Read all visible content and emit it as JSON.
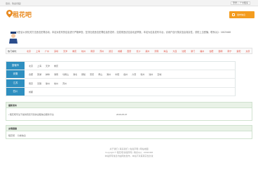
{
  "top": {
    "welcome": "您好，欢迎光临！",
    "login": "登录",
    "register": "广州租房"
  },
  "logo": {
    "text": "租花吧"
  },
  "post_button": {
    "label": "发布信息"
  },
  "notice": {
    "text": "为配合公安机关打击违法犯罪活动，本站对发布的信息进行严格审查，坚决杜绝违法犯罪信息的发布，如发现违法信息欢迎举报。本站为信息发布平台，请用户自行核实信息真实性，谨防上当受骗。联系QQ：16020468"
  },
  "cities": {
    "label": "热门城市：",
    "items": [
      "北京",
      "上海",
      "广州",
      "深圳",
      "天津",
      "重庆",
      "杭州",
      "南京",
      "苏州",
      "武汉",
      "成都",
      "西安",
      "长沙",
      "郑州",
      "济南",
      "青岛",
      "大连",
      "沈阳",
      "厦门",
      "福州",
      "合肥",
      "昆明",
      "南宁",
      "贵阳",
      "太原",
      "石家庄",
      "兰州",
      "海口"
    ]
  },
  "regions": [
    {
      "name": "直辖市",
      "items": [
        "北京",
        "上海",
        "天津",
        "重庆"
      ]
    },
    {
      "name": "安徽",
      "items": [
        "合肥",
        "芜湖",
        "蚌埠",
        "淮南",
        "马鞍山",
        "淮北",
        "铜陵",
        "安庆",
        "黄山",
        "滁州",
        "阜阳",
        "宿州",
        "六安",
        "亳州",
        "池州",
        "宣城"
      ]
    },
    {
      "name": "江苏",
      "items": [
        "南京",
        "无锡",
        "徐州",
        "常州",
        "苏州"
      ]
    },
    {
      "name": "四川",
      "items": [
        "成都"
      ]
    }
  ],
  "latest": {
    "title": "最新发布",
    "entry_text": "• 租花吧专注于提供真实可靠的出租信息服务平台",
    "entry_date": "2016-05-07"
  },
  "links": {
    "title": "友情链接",
    "items": [
      "租花吧",
      "分类信息"
    ]
  },
  "footer": {
    "line1": "关于我们 | 联系我们 | 免责声明 | 网站地图",
    "line2": "Copyright © 租花吧 版权所有 | 联系QQ：16020468",
    "line3": "本站所有信息均由网友发布，本站不对其真实性负责"
  },
  "colors": {
    "accent": "#f39c1f",
    "region_head": "#2e8fc0",
    "city_link": "#e04a3a",
    "box_head": "#e9f2e7"
  }
}
